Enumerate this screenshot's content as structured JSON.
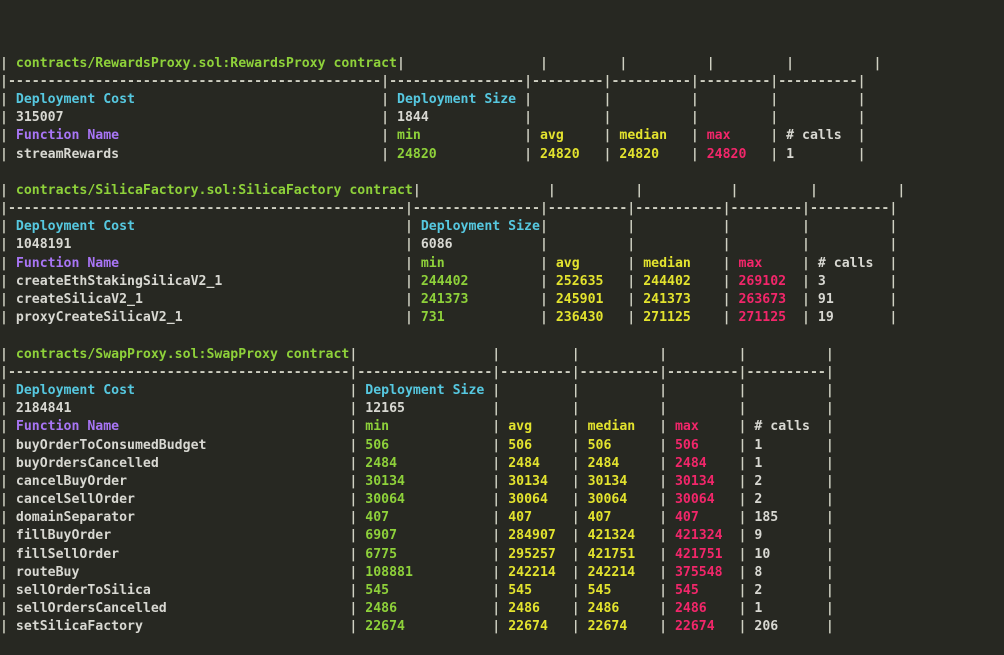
{
  "terminal": {
    "background": "#272822",
    "colors": {
      "frame": "#cfd0c2",
      "contract_title": "#8ed13a",
      "deployment_header": "#56c8e0",
      "function_name_header": "#a875f5",
      "min": "#8ed13a",
      "avg": "#e3e32e",
      "median": "#e3e32e",
      "max": "#f2266a",
      "calls": "#d8d8d2",
      "plain": "#d8d8d2"
    },
    "headers": {
      "deployment_cost": "Deployment Cost",
      "deployment_size": "Deployment Size",
      "function_name": "Function Name",
      "min": "min",
      "avg": "avg",
      "median": "median",
      "max": "max",
      "calls": "# calls"
    },
    "tables": [
      {
        "title": "contracts/RewardsProxy.sol:RewardsProxy contract",
        "deployment_cost": "315007",
        "deployment_size": "1844",
        "col_widths": {
          "name": 47,
          "min": 17,
          "avg": 9,
          "median": 10,
          "max": 9,
          "calls": 10
        },
        "functions": [
          {
            "name": "streamRewards",
            "min": "24820",
            "avg": "24820",
            "median": "24820",
            "max": "24820",
            "calls": "1"
          }
        ]
      },
      {
        "title": "contracts/SilicaFactory.sol:SilicaFactory contract",
        "deployment_cost": "1048191",
        "deployment_size": "6086",
        "col_widths": {
          "name": 50,
          "min": 16,
          "avg": 10,
          "median": 11,
          "max": 9,
          "calls": 10
        },
        "functions": [
          {
            "name": "createEthStakingSilicaV2_1",
            "min": "244402",
            "avg": "252635",
            "median": "244402",
            "max": "269102",
            "calls": "3"
          },
          {
            "name": "createSilicaV2_1",
            "min": "241373",
            "avg": "245901",
            "median": "241373",
            "max": "263673",
            "calls": "91"
          },
          {
            "name": "proxyCreateSilicaV2_1",
            "min": "731",
            "avg": "236430",
            "median": "271125",
            "max": "271125",
            "calls": "19"
          }
        ]
      },
      {
        "title": "contracts/SwapProxy.sol:SwapProxy contract",
        "deployment_cost": "2184841",
        "deployment_size": "12165",
        "col_widths": {
          "name": 43,
          "min": 17,
          "avg": 9,
          "median": 10,
          "max": 9,
          "calls": 10
        },
        "functions": [
          {
            "name": "buyOrderToConsumedBudget",
            "min": "506",
            "avg": "506",
            "median": "506",
            "max": "506",
            "calls": "1"
          },
          {
            "name": "buyOrdersCancelled",
            "min": "2484",
            "avg": "2484",
            "median": "2484",
            "max": "2484",
            "calls": "1"
          },
          {
            "name": "cancelBuyOrder",
            "min": "30134",
            "avg": "30134",
            "median": "30134",
            "max": "30134",
            "calls": "2"
          },
          {
            "name": "cancelSellOrder",
            "min": "30064",
            "avg": "30064",
            "median": "30064",
            "max": "30064",
            "calls": "2"
          },
          {
            "name": "domainSeparator",
            "min": "407",
            "avg": "407",
            "median": "407",
            "max": "407",
            "calls": "185"
          },
          {
            "name": "fillBuyOrder",
            "min": "6907",
            "avg": "284907",
            "median": "421324",
            "max": "421324",
            "calls": "9"
          },
          {
            "name": "fillSellOrder",
            "min": "6775",
            "avg": "295257",
            "median": "421751",
            "max": "421751",
            "calls": "10"
          },
          {
            "name": "routeBuy",
            "min": "108881",
            "avg": "242214",
            "median": "242214",
            "max": "375548",
            "calls": "8"
          },
          {
            "name": "sellOrderToSilica",
            "min": "545",
            "avg": "545",
            "median": "545",
            "max": "545",
            "calls": "2"
          },
          {
            "name": "sellOrdersCancelled",
            "min": "2486",
            "avg": "2486",
            "median": "2486",
            "max": "2486",
            "calls": "1"
          },
          {
            "name": "setSilicaFactory",
            "min": "22674",
            "avg": "22674",
            "median": "22674",
            "max": "22674",
            "calls": "206"
          }
        ]
      }
    ]
  }
}
